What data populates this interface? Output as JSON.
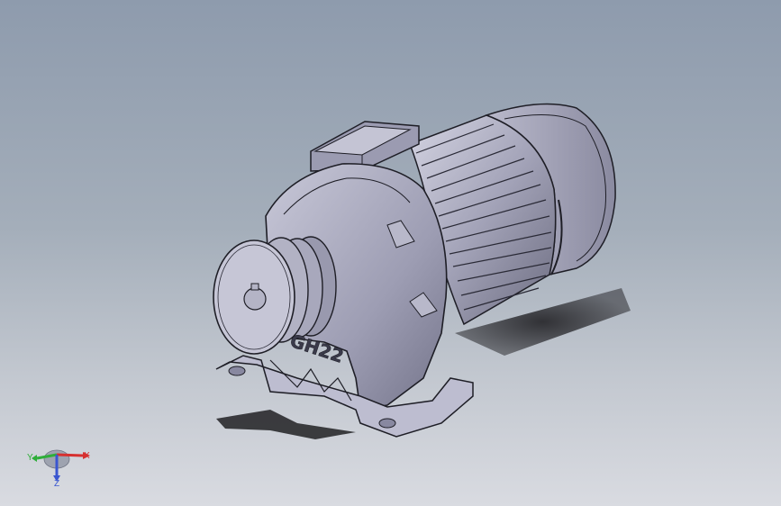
{
  "viewport": {
    "background_top": "#8e9bad",
    "background_bottom": "#d9dbe1"
  },
  "model": {
    "casting_mark": "GH22",
    "body_color": "#a7a7bd",
    "shadow_color": "#2a2a2e"
  },
  "triad": {
    "x_label": "X",
    "y_label": "Y",
    "z_label": "Z",
    "x_color": "#d63030",
    "y_color": "#2fae3a",
    "z_color": "#3a56d0"
  }
}
